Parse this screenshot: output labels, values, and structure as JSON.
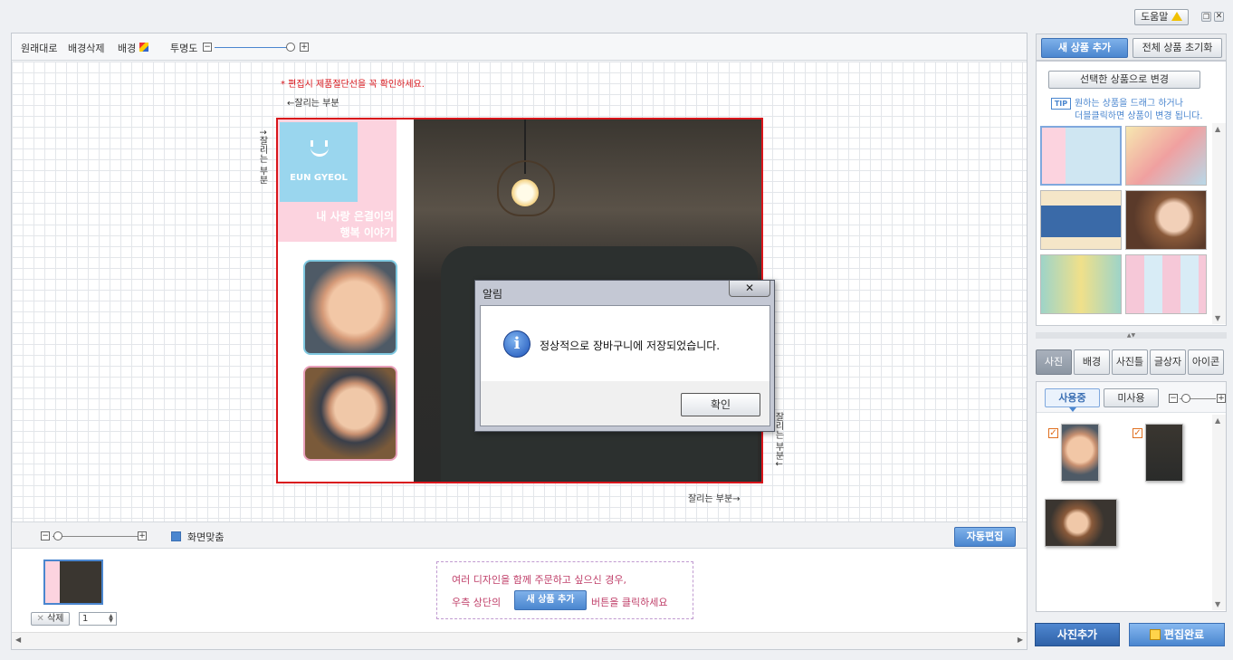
{
  "help": {
    "label": "도움말"
  },
  "toolbar": {
    "original": "원래대로",
    "delete_bg": "배경삭제",
    "bg": "배경",
    "opacity": "투명도"
  },
  "canvas": {
    "warning": "* 편집시 제품절단선을 꼭 확인하세요.",
    "cut_top": "←잘리는 부분",
    "cut_left": "↑잘리는 부분",
    "cut_right": "잘리는 부분↓",
    "cut_bottom": "잘리는 부분→"
  },
  "design": {
    "name": "EUN GYEOL",
    "caption_line1": "내 사랑 은결이의",
    "caption_line2": "행복 이야기"
  },
  "dialog": {
    "title": "알림",
    "message": "정상적으로 장바구니에 저장되었습니다.",
    "ok": "확인"
  },
  "bottom_bar": {
    "fit": "화면맞춤",
    "auto_edit": "자동편집"
  },
  "pages": {
    "delete": "삭제",
    "count": "1"
  },
  "notice": {
    "line1": "여러 디자인을 함께 주문하고 싶으신 경우,",
    "line2_pre": "우측 상단의",
    "line2_btn": "새 상품 추가",
    "line2_post": "버튼을 클릭하세요"
  },
  "right": {
    "add_new": "새 상품 추가",
    "reset_all": "전체 상품 초기화",
    "change_selected": "선택한 상품으로 변경",
    "tip_badge": "TIP",
    "tip_line1": "원하는 상품을 드래그 하거나",
    "tip_line2": "더블클릭하면 상품이 변경 됩니다.",
    "tabs": [
      "사진",
      "배경",
      "사진틀",
      "글상자",
      "아이콘"
    ],
    "used": "사용중",
    "unused": "미사용",
    "add_photo": "사진추가",
    "finish": "편집완료"
  },
  "colors": {
    "accent": "#4a86cf",
    "cut_line": "#d9151b",
    "pink": "#fcd3df",
    "notice_text": "#c0406a"
  }
}
